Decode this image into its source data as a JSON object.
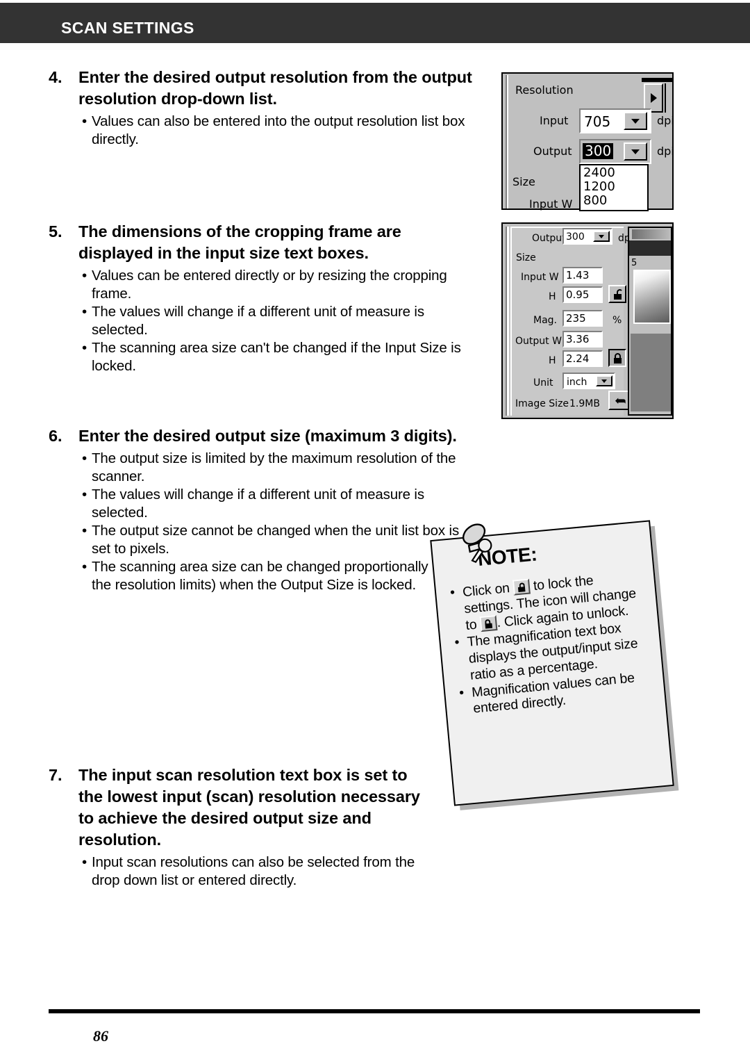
{
  "header": {
    "title": "SCAN SETTINGS"
  },
  "footer": {
    "page_number": "86"
  },
  "steps": [
    {
      "number": "4.",
      "title": "Enter the desired output resolution from the output resolution drop-down list.",
      "bullets": [
        "Values can also be entered into the output resolution list box directly."
      ]
    },
    {
      "number": "5.",
      "title": "The dimensions of the cropping frame are displayed in the input size text boxes.",
      "bullets": [
        "Values can be entered directly or by resizing the cropping frame.",
        "The values will change if a different unit of measure is selected.",
        "The scanning area size can't be changed if the Input Size is locked."
      ]
    },
    {
      "number": "6.",
      "title": "Enter the desired output size (maximum 3 digits).",
      "bullets": [
        "The output size is limited by the maximum resolution of the scanner.",
        "The values will change if a different unit of measure is selected.",
        "The output size cannot be changed when the unit list box is set to pixels.",
        "The scanning area size can be changed proportionally (within the resolution limits) when the Output Size is locked."
      ]
    },
    {
      "number": "7.",
      "title": "The input scan resolution text box is set to the lowest input (scan) resolution necessary to achieve the desired output size and resolution.",
      "bullets": [
        "Input scan resolutions can also be selected from the drop down list or entered directly."
      ]
    }
  ],
  "resolution_dialog": {
    "group_label": "Resolution",
    "expand_arrow_icon": "triangle-right-icon",
    "input_label": "Input",
    "input_value": "705",
    "input_unit": "dpi",
    "output_label": "Output",
    "output_value": "300",
    "output_unit": "dpi",
    "size_label": "Size",
    "input_w_label": "Input W",
    "dropdown_options": [
      "2400",
      "1200",
      "800"
    ],
    "dropdown_icon": "triangle-down-icon"
  },
  "size_dialog": {
    "output_label": "Output",
    "output_value": "300",
    "output_unit": "dpi",
    "size_label": "Size",
    "input_w_label": "Input W",
    "input_w_value": "1.43",
    "input_h_label": "H",
    "input_h_value": "0.95",
    "input_lock_icon": "lock-open-icon",
    "mag_label": "Mag.",
    "mag_value": "235",
    "mag_unit": "%",
    "output_w_label": "Output W",
    "output_w_value": "3.36",
    "output_h_label": "H",
    "output_h_value": "2.24",
    "output_lock_icon": "lock-closed-icon",
    "unit_label": "Unit",
    "unit_value": "inch",
    "image_size_label": "Image Size",
    "image_size_value": "1.9MB",
    "reset_icon": "undo-arrow-icon",
    "dropdown_icon": "triangle-down-icon",
    "preview_index": "5"
  },
  "note": {
    "title": "NOTE:",
    "pin_icon": "pushpin-icon",
    "bullets": [
      {
        "part1": "Click on",
        "icon1": "lock-open-icon",
        "part2": "to lock the settings. The icon will change to",
        "icon2": "lock-closed-icon",
        "part3": ". Click again to unlock."
      },
      {
        "text": "The magnification text box displays the output/input size ratio as a percentage."
      },
      {
        "text": "Magnification values can be entered directly."
      }
    ]
  }
}
